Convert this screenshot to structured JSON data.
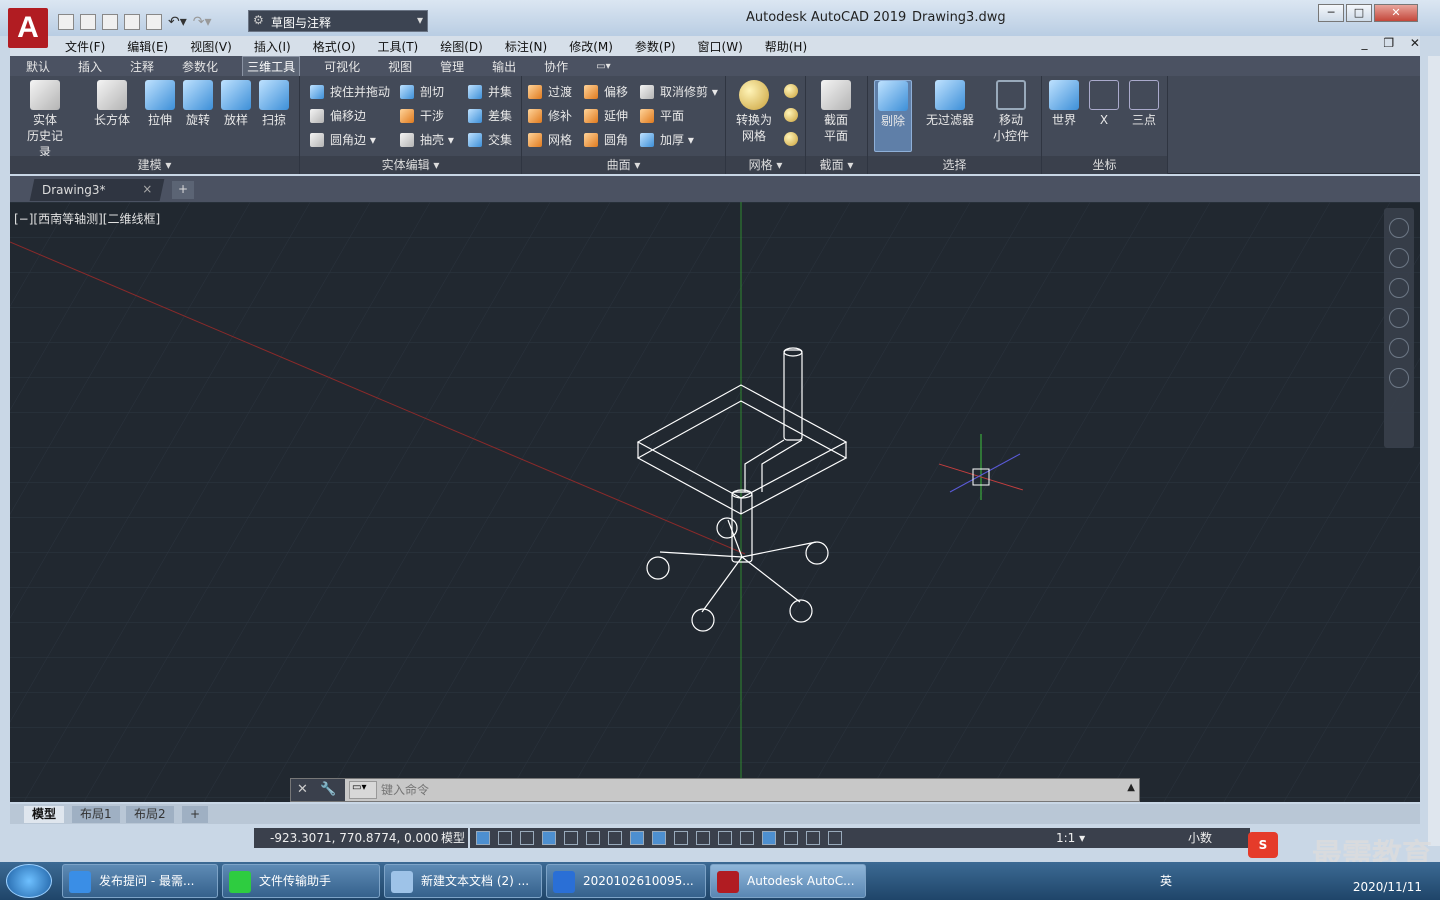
{
  "titlebar": {
    "logo": "A",
    "workspace": "草图与注释",
    "app_title": "Autodesk AutoCAD 2019",
    "file_title": "Drawing3.dwg",
    "min": "─",
    "max": "□",
    "close": "✕"
  },
  "menu": [
    "文件(F)",
    "编辑(E)",
    "视图(V)",
    "插入(I)",
    "格式(O)",
    "工具(T)",
    "绘图(D)",
    "标注(N)",
    "修改(M)",
    "参数(P)",
    "窗口(W)",
    "帮助(H)"
  ],
  "ribbon_tabs": [
    "默认",
    "插入",
    "注释",
    "参数化",
    "三维工具",
    "可视化",
    "视图",
    "管理",
    "输出",
    "协作"
  ],
  "ribbon": {
    "modeling": {
      "label": "建模 ▾",
      "solid_history": "实体\n历史记录",
      "box": "长方体",
      "extrude": "拉伸",
      "revolve": "旋转",
      "loft": "放样",
      "sweep": "扫掠"
    },
    "solid_edit": {
      "label": "实体编辑 ▾",
      "presspull": "按住并拖动",
      "offset_edge": "偏移边",
      "fillet_edge": "圆角边 ▾",
      "slice": "剖切",
      "interfere": "干涉",
      "shell": "抽壳 ▾",
      "union": "并集",
      "subtract": "差集",
      "intersect": "交集"
    },
    "surface": {
      "label": "曲面 ▾",
      "blend": "过渡",
      "patch": "修补",
      "network": "网格",
      "offset": "偏移",
      "extend": "延伸",
      "fillet": "圆角",
      "untrim": "取消修剪 ▾",
      "planar": "平面",
      "thicken": "加厚 ▾"
    },
    "mesh": {
      "label": "网格 ▾",
      "convert": "转换为\n网格"
    },
    "section": {
      "label": "截面 ▾",
      "plane": "截面\n平面"
    },
    "selection": {
      "label": "选择",
      "cull": "剔除",
      "no_filter": "无过滤器",
      "gizmo": "移动\n小控件"
    },
    "coordinates": {
      "label": "坐标",
      "world": "世界",
      "x": "X",
      "three_point": "三点"
    }
  },
  "doc_tab": {
    "name": "Drawing3*",
    "close": "×",
    "add": "+"
  },
  "viewport": {
    "label": "[−][西南等轴测][二维线框]",
    "model": "office swivel chair wireframe"
  },
  "command": {
    "placeholder": "键入命令",
    "close": "✕",
    "wrench": "🔧"
  },
  "layout_tabs": [
    "模型",
    "布局1",
    "布局2",
    "+"
  ],
  "status": {
    "coords": "-923.3071, 770.8774, 0.0000",
    "model": "模型",
    "scale": "1:1 ▾",
    "units": "小数"
  },
  "taskbar": {
    "tasks": [
      "发布提问 - 最需...",
      "文件传输助手",
      "新建文本文档 (2) ...",
      "2020102610095...",
      "Autodesk AutoC..."
    ],
    "date": "2020/11/11",
    "ime": "英"
  },
  "watermark": "最需教育",
  "colors": {
    "viewport_bg": "#212830",
    "ribbon_bg": "#434a58",
    "grid": "#2c3540",
    "y_axis": "#2f8a2f",
    "x_axis": "#8a2a2a",
    "wire": "#ffffff"
  }
}
